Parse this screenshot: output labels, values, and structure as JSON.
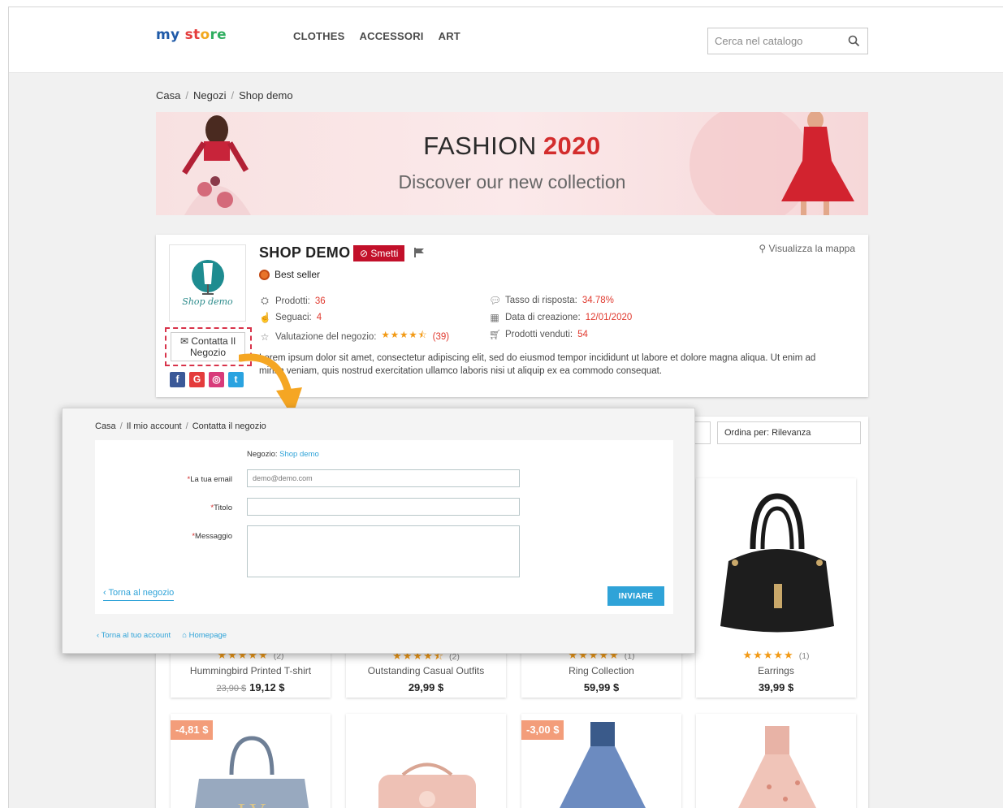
{
  "header": {
    "logo": [
      "my",
      " ",
      "st",
      "o",
      "re"
    ],
    "nav": [
      "CLOTHES",
      "ACCESSORI",
      "ART"
    ],
    "search_placeholder": "Cerca nel catalogo"
  },
  "breadcrumb": [
    "Casa",
    "Negozi",
    "Shop demo"
  ],
  "banner": {
    "title": "FASHION",
    "year": "2020",
    "subtitle": "Discover our new collection"
  },
  "shop": {
    "logo_text": "Shop demo",
    "name": "SHOP DEMO",
    "unfollow_label": "Smetti",
    "badge": "Best seller",
    "map_link": "Visualizza la mappa",
    "contact_label": "Contatta Il Negozio",
    "stats_left": [
      {
        "label": "Prodotti:",
        "value": "36",
        "icon": "products-icon"
      },
      {
        "label": "Seguaci:",
        "value": "4",
        "icon": "thumbs-up-icon"
      },
      {
        "label": "Valutazione del negozio:",
        "value": "(39)",
        "icon": "star-outline-icon",
        "stars": "★★★★⯪"
      }
    ],
    "stats_right": [
      {
        "label": "Tasso di risposta:",
        "value": "34.78%",
        "icon": "comment-icon"
      },
      {
        "label": "Data di creazione:",
        "value": "12/01/2020",
        "icon": "calendar-icon"
      },
      {
        "label": "Prodotti venduti:",
        "value": "54",
        "icon": "cart-icon"
      }
    ],
    "description": "Lorem ipsum dolor sit amet, consectetur adipiscing elit, sed do eiusmod tempor incididunt ut labore et dolore magna aliqua. Ut enim ad minim veniam, quis nostrud exercitation ullamco laboris nisi ut aliquip ex ea commodo consequat.",
    "social": [
      "f",
      "G",
      "◎",
      "t"
    ]
  },
  "sort": {
    "label": "Ordina per:",
    "value": "Rilevanza"
  },
  "products": [
    {
      "name": "Hummingbird Printed T-shirt",
      "stars": "★★★★★",
      "count": "(2)",
      "old_price": "23,90 $",
      "price": "19,12 $"
    },
    {
      "name": "Outstanding Casual Outfits",
      "stars": "★★★★⯪",
      "count": "(2)",
      "old_price": "",
      "price": "29,99 $"
    },
    {
      "name": "Ring Collection",
      "stars": "★★★★★",
      "count": "(1)",
      "old_price": "",
      "price": "59,99 $"
    },
    {
      "name": "Earrings",
      "stars": "★★★★★",
      "count": "(1)",
      "old_price": "",
      "price": "39,99 $"
    }
  ],
  "row2_badges": [
    "-4,81 $",
    "",
    "-3,00 $",
    ""
  ],
  "contact_form": {
    "breadcrumb": [
      "Casa",
      "Il mio account",
      "Contatta il negozio"
    ],
    "shop_label": "Negozio:",
    "shop_link": "Shop demo",
    "email_label": "La tua email",
    "email_placeholder": "demo@demo.com",
    "title_label": "Titolo",
    "message_label": "Messaggio",
    "back_link": "Torna al negozio",
    "send_label": "INVIARE",
    "footer_links": [
      "Torna al tuo account",
      "Homepage"
    ]
  },
  "colors": {
    "accent": "#2fa3d8",
    "danger": "#c2102a",
    "star": "#f29a16",
    "badge": "#f39d7a"
  }
}
